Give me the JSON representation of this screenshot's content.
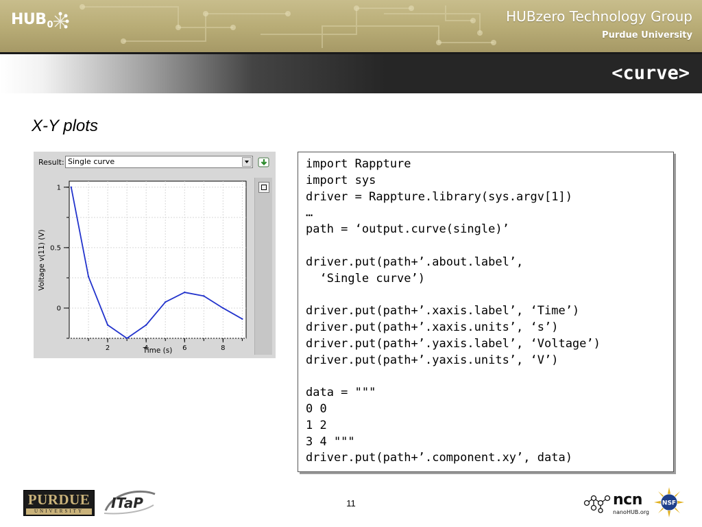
{
  "header": {
    "logo_text": "HUB",
    "logo_sub": "0",
    "group_title": "HUBzero Technology Group",
    "group_subtitle": "Purdue University",
    "slide_title": "<curve>"
  },
  "subtitle": "X-Y plots",
  "rappture_panel": {
    "result_label": "Result:",
    "result_value": "Single curve",
    "download_icon": "download-arrow-icon",
    "zoom_icon": "zoom-reset-icon"
  },
  "chart_data": {
    "type": "line",
    "title": "",
    "xlabel": "Time (s)",
    "ylabel": "Voltage v(11) (V)",
    "xlim": [
      0,
      9.2
    ],
    "ylim": [
      -0.25,
      1.05
    ],
    "x_ticks": [
      2,
      4,
      6,
      8
    ],
    "y_ticks": [
      0,
      0.5,
      1
    ],
    "x_tick_labels": [
      "2",
      "4",
      "6",
      "8"
    ],
    "y_tick_labels": [
      "0",
      "0.5",
      "1"
    ],
    "grid": true,
    "series": [
      {
        "color": "#2233cc",
        "x": [
          0.1,
          1.0,
          2.0,
          3.0,
          4.0,
          5.0,
          6.0,
          7.0,
          8.0,
          9.0
        ],
        "y": [
          1.0,
          0.26,
          -0.14,
          -0.25,
          -0.14,
          0.05,
          0.13,
          0.1,
          0.0,
          -0.09
        ]
      }
    ]
  },
  "code_lines": [
    "import Rappture",
    "import sys",
    "driver = Rappture.library(sys.argv[1])",
    "…",
    "path = ‘output.curve(single)’",
    "",
    "driver.put(path+’.about.label’,",
    "  ‘Single curve’)",
    "",
    "driver.put(path+’.xaxis.label’, ‘Time’)",
    "driver.put(path+’.xaxis.units’, ‘s’)",
    "driver.put(path+’.yaxis.label’, ‘Voltage’)",
    "driver.put(path+’.yaxis.units’, ‘V’)",
    "",
    "data = \"\"\"",
    "0 0",
    "1 2",
    "3 4 \"\"\"",
    "driver.put(path+’.component.xy’, data)"
  ],
  "footer": {
    "purdue_word": "PURDUE",
    "purdue_uni": "UNIVERSITY",
    "itap_text": "ITaP",
    "page_number": "11",
    "ncn_word": "ncn",
    "ncn_url": "nanoHUB.org",
    "nsf_text": "NSF"
  },
  "colors": {
    "banner_gold": "#b9ad77",
    "title_bar_dark": "#262626",
    "curve_blue": "#2233cc",
    "panel_gray": "#d7d7d7",
    "purdue_gold": "#c9b27a"
  }
}
